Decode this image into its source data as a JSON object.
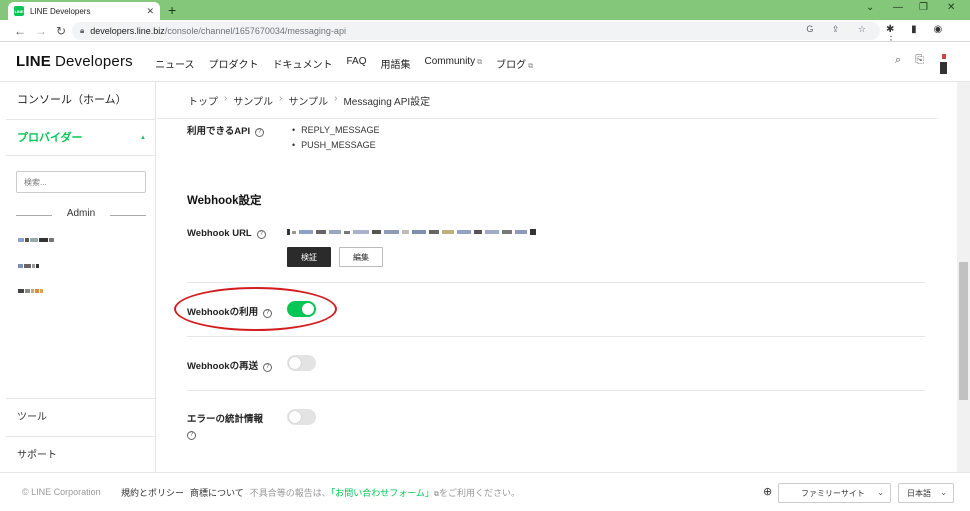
{
  "browser": {
    "tab_title": "LINE Developers",
    "tab_close": "✕",
    "new_tab": "+",
    "url_host": "developers.line.biz",
    "url_path": "/console/channel/1657670034/messaging-api",
    "window_controls": [
      "⌄",
      "—",
      "❐",
      "✕"
    ]
  },
  "header": {
    "logo_line": "LINE",
    "logo_developers": "Developers",
    "nav": [
      {
        "label": "ニュース",
        "external": false
      },
      {
        "label": "プロダクト",
        "external": false
      },
      {
        "label": "ドキュメント",
        "external": false
      },
      {
        "label": "FAQ",
        "external": false
      },
      {
        "label": "用語集",
        "external": false
      },
      {
        "label": "Community",
        "external": true
      },
      {
        "label": "ブログ",
        "external": true
      }
    ]
  },
  "sidebar": {
    "home": "コンソール（ホーム）",
    "provider": "プロバイダー",
    "search_placeholder": "検索...",
    "admin": "Admin",
    "tools": "ツール",
    "support": "サポート"
  },
  "breadcrumb": [
    "トップ",
    "サンプル",
    "サンプル",
    "Messaging API設定"
  ],
  "main": {
    "available_api_label": "利用できるAPI",
    "apis": [
      "REPLY_MESSAGE",
      "PUSH_MESSAGE"
    ],
    "webhook_section_title": "Webhook設定",
    "webhook_url_label": "Webhook URL",
    "verify_button": "検証",
    "edit_button": "編集",
    "use_webhook_label": "Webhookの利用",
    "use_webhook_enabled": true,
    "redelivery_label": "Webhookの再送",
    "redelivery_enabled": false,
    "error_stats_label": "エラーの統計情報",
    "error_stats_enabled": false
  },
  "footer": {
    "copyright": "© LINE Corporation",
    "terms": "規約とポリシー",
    "trademark": "商標について",
    "report_prefix": "不具合等の報告は、",
    "contact_link": "「お問い合わせフォーム」",
    "report_suffix": "をご利用ください。",
    "family_site": "ファミリーサイト",
    "language": "日本語"
  },
  "colors": {
    "line_green": "#06c755",
    "chrome_green": "#84c77b",
    "highlight_red": "#d21e1e"
  }
}
